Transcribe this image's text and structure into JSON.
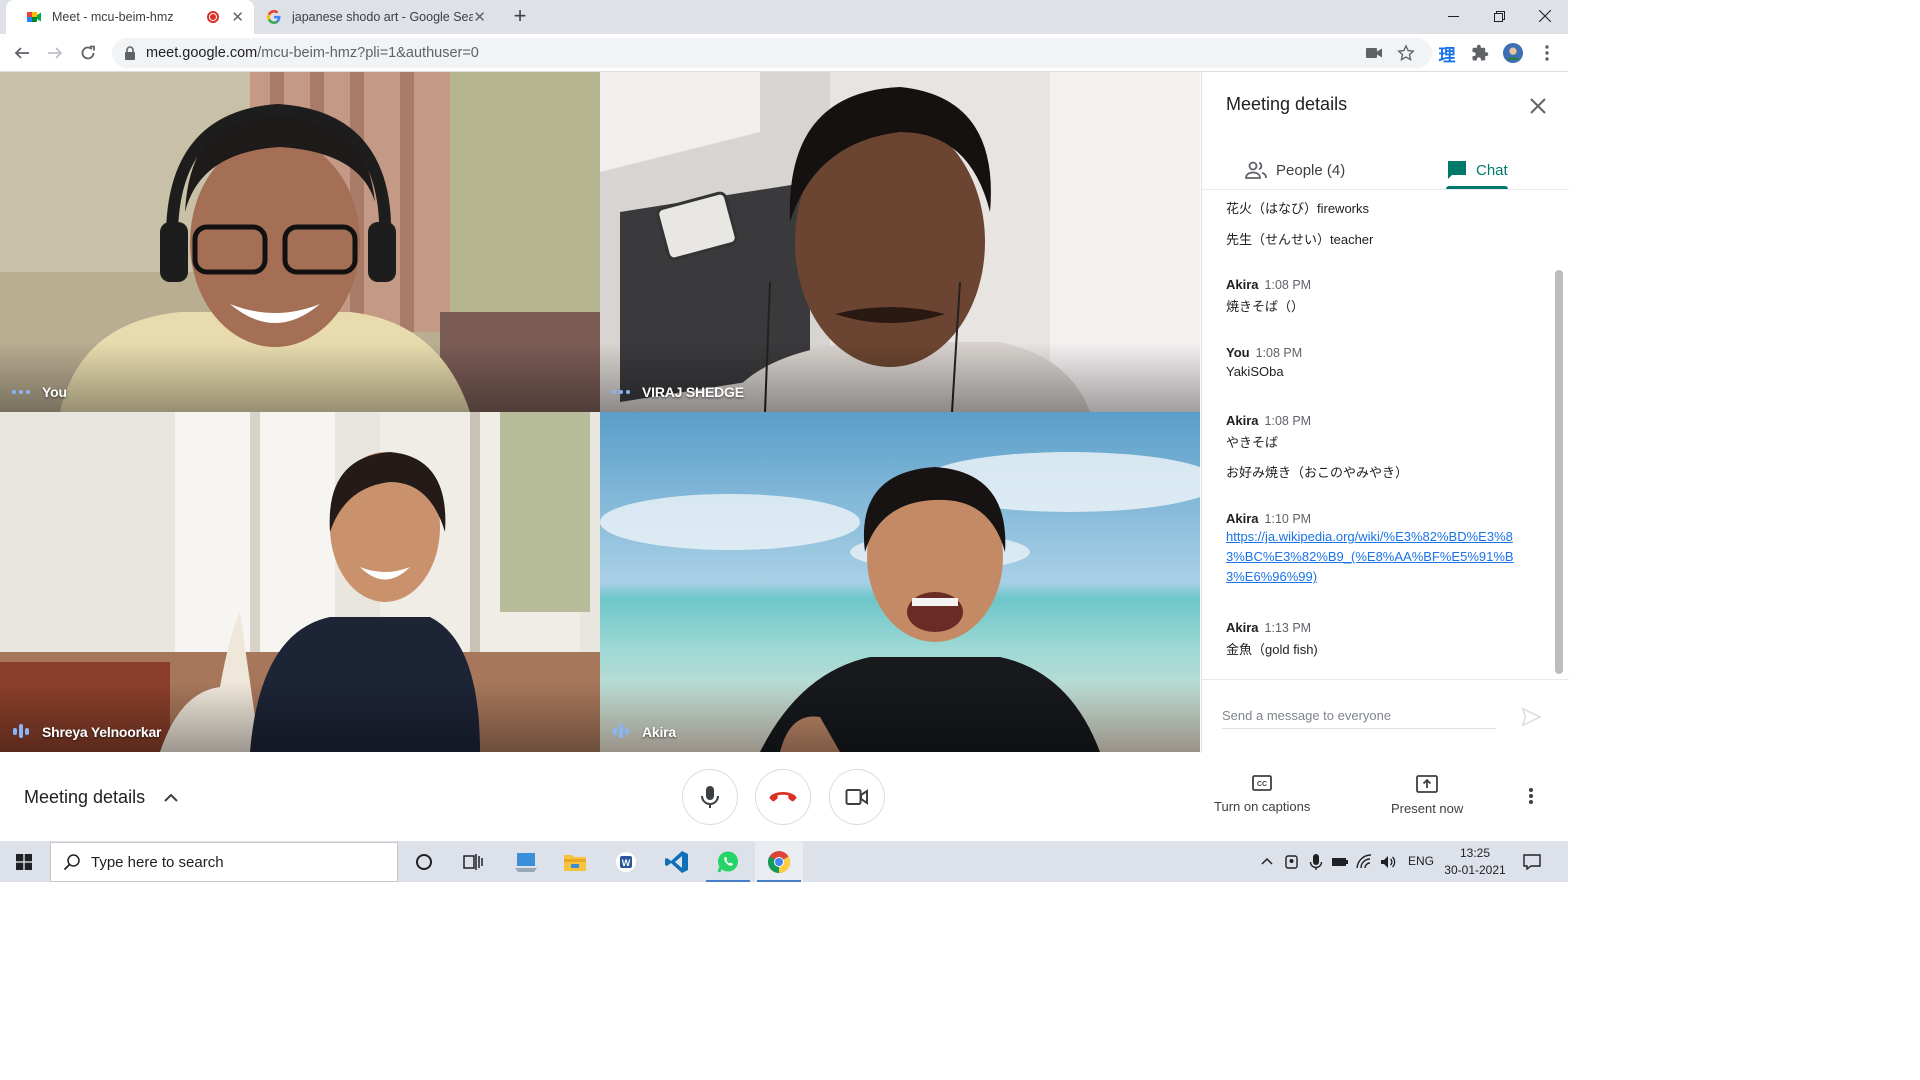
{
  "browser": {
    "tabs": [
      {
        "title": "Meet - mcu-beim-hmz",
        "active": true,
        "recording": true
      },
      {
        "title": "japanese shodo art - Google Sea",
        "active": false
      }
    ],
    "url_host": "meet.google.com",
    "url_path": "/mcu-beim-hmz?pli=1&authuser=0"
  },
  "participants": [
    {
      "name": "You",
      "indicator": "dots"
    },
    {
      "name": "VIRAJ SHEDGE",
      "indicator": "dots"
    },
    {
      "name": "Shreya Yelnoorkar",
      "indicator": "bars"
    },
    {
      "name": "Akira",
      "indicator": "bars"
    }
  ],
  "panel": {
    "title": "Meeting details",
    "people_tab": "People (4)",
    "chat_tab": "Chat",
    "messages": [
      {
        "text": "花火（はなび）fireworks"
      },
      {
        "text": "先生（せんせい）teacher"
      },
      {
        "sender": "Akira",
        "time": "1:08 PM"
      },
      {
        "text": "焼きそば（）"
      },
      {
        "sender": "You",
        "time": "1:08 PM"
      },
      {
        "text": "YakiSOba"
      },
      {
        "sender": "Akira",
        "time": "1:08 PM"
      },
      {
        "text": "やきそば"
      },
      {
        "text": "お好み焼き（おこのやみやき）"
      },
      {
        "sender": "Akira",
        "time": "1:10 PM"
      },
      {
        "link": "https://ja.wikipedia.org/wiki/%E3%82%BD%E3%83%BC%E3%82%B9_(%E8%AA%BF%E5%91%B3%E6%96%99)"
      },
      {
        "sender": "Akira",
        "time": "1:13 PM"
      },
      {
        "text": "金魚（gold fish)"
      }
    ],
    "compose_placeholder": "Send a message to everyone"
  },
  "bottom": {
    "meeting_details": "Meeting details",
    "captions": "Turn on captions",
    "present": "Present now"
  },
  "taskbar": {
    "search_placeholder": "Type here to search",
    "lang": "ENG",
    "time": "13:25",
    "date": "30-01-2021"
  },
  "colors": {
    "accent": "#00796b",
    "link": "#1a73e8",
    "speaking": "#8ab4f8",
    "hangup": "#d93025"
  }
}
